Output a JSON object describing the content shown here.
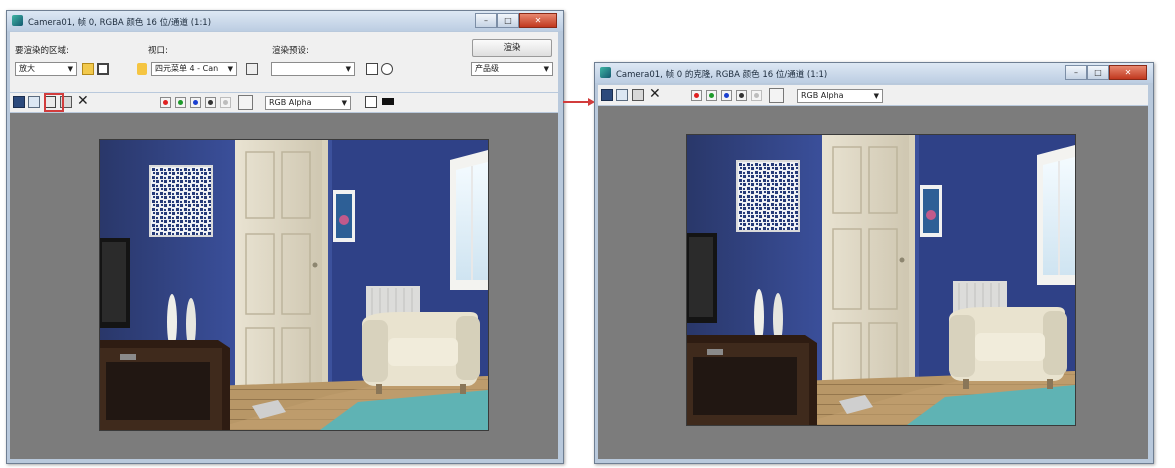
{
  "left_window": {
    "title": "Camera01, 帧 0, RGBA 颜色 16 位/通道 (1:1)",
    "render_area_label": "要渲染的区域:",
    "render_area_value": "放大",
    "viewport_label": "视口:",
    "viewport_value": "四元菜单 4 - Can",
    "preset_label": "渲染预设:",
    "preset_value": "",
    "render_button": "渲染",
    "product_value": "产品级",
    "channel_value": "RGB Alpha"
  },
  "right_window": {
    "title": "Camera01, 帧 0 的克隆, RGBA 颜色 16 位/通道 (1:1)",
    "channel_value": "RGB Alpha"
  },
  "window_buttons": {
    "min": "–",
    "max": "□",
    "close": "✕"
  },
  "icons": [
    "render-window-icon",
    "save-image-icon",
    "copy-image-icon",
    "clone-window-icon",
    "print-image-icon",
    "clear-icon",
    "red-channel-icon",
    "green-channel-icon",
    "blue-channel-icon",
    "alpha-channel-icon",
    "monochrome-icon",
    "background-swatch-icon",
    "frame-icon",
    "mask-icon",
    "lock-icon",
    "environment-icon",
    "teapot-icon"
  ],
  "colors": {
    "highlight": "#d23c3c",
    "red_channel": "#e02020",
    "green_channel": "#1d9a2a",
    "blue_channel": "#1a3fd0"
  }
}
